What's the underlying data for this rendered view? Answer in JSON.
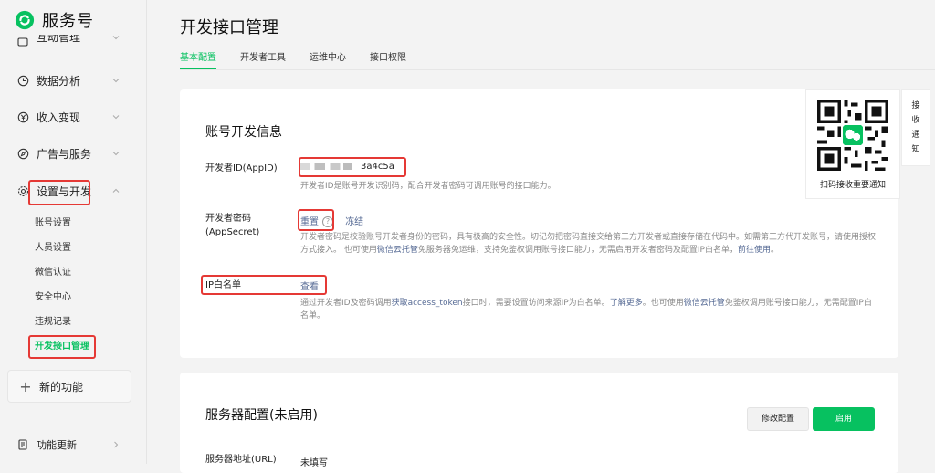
{
  "brand": {
    "name": "服务号"
  },
  "sidebar": {
    "clipped_item": "互动管理",
    "items": [
      {
        "label": "数据分析",
        "icon": "chart-clock-icon"
      },
      {
        "label": "收入变现",
        "icon": "yen-icon"
      },
      {
        "label": "广告与服务",
        "icon": "compass-icon"
      },
      {
        "label": "设置与开发",
        "icon": "gear-icon"
      }
    ],
    "sub_items": [
      "账号设置",
      "人员设置",
      "微信认证",
      "安全中心",
      "违规记录",
      "开发接口管理"
    ],
    "new_func": "新的功能",
    "bottom_item": "功能更新"
  },
  "main": {
    "title": "开发接口管理",
    "tabs": [
      "基本配置",
      "开发者工具",
      "运维中心",
      "接口权限"
    ],
    "section1_title": "账号开发信息",
    "appid": {
      "label": "开发者ID(AppID)",
      "value_suffix": "3a4c5a",
      "desc": "开发者ID是账号开发识别码，配合开发者密码可调用账号的接口能力。"
    },
    "secret": {
      "label": "开发者密码(AppSecret)",
      "reset": "重置",
      "freeze": "冻结",
      "desc_1": "开发者密码是校验账号开发者身份的密码，具有极高的安全性。切记勿把密码直接交给第三方开发者或直接存储在代码中。如需第三方代开发账号，请使用授权方式接入。 也可使用",
      "desc_link1": "微信云托管",
      "desc_2": "免服务器免运维，支持免鉴权调用账号接口能力，无需启用开发者密码及配置IP白名单，",
      "desc_link2": "前往使用",
      "desc_end": "。"
    },
    "ip": {
      "label": "IP白名单",
      "view": "查看",
      "desc_1": "通过开发者ID及密码调用",
      "desc_link1": "获取access_token",
      "desc_2": "接口时，需要设置访问来源IP为白名单。",
      "desc_link2": "了解更多",
      "desc_3": "。也可使用",
      "desc_link3": "微信云托管",
      "desc_4": "免鉴权调用账号接口能力，无需配置IP白名单。"
    },
    "section2_title": "服务器配置(未启用)",
    "modify_btn": "修改配置",
    "enable_btn": "启用",
    "server_url_label": "服务器地址(URL)",
    "server_url_value": "未填写"
  },
  "qr": {
    "caption": "扫码接收重要通知"
  },
  "notify_tab": [
    "接",
    "收",
    "通",
    "知"
  ],
  "colors": {
    "accent": "#07c160",
    "link": "#576b95",
    "highlight_box": "#e53935"
  }
}
